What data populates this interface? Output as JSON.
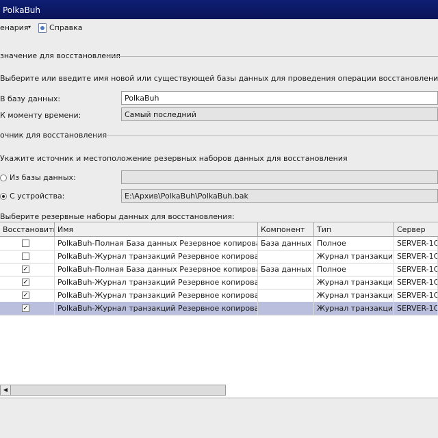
{
  "window": {
    "title": "PolkaBuh"
  },
  "toolbar": {
    "script_label": "енария",
    "script_arrow": "▾",
    "help_label": "Справка"
  },
  "destination": {
    "title": "значение для восстановления",
    "description": "Выберите или введите имя новой или существующей базы данных для проведения операции восстановления",
    "database_label": "В базу данных:",
    "database_value": "PolkaBuh",
    "point_in_time_label": "К моменту времени:",
    "point_in_time_value": "Самый последний"
  },
  "source": {
    "title": "очник для восстановления",
    "description": "Укажите источник и местоположение резервных наборов данных для восстановления",
    "from_database_label": "Из базы данных:",
    "from_database_value": "",
    "from_device_label": "С устройства:",
    "from_device_value": "E:\\Архив\\PolkaBuh\\PolkaBuh.bak"
  },
  "backup_sets": {
    "title": "Выберите резервные наборы данных для восстановления:",
    "columns": [
      "Восстановить",
      "Имя",
      "Компонент",
      "Тип",
      "Сервер"
    ],
    "rows": [
      {
        "restore": false,
        "name": "PolkaBuh-Полная База данных Резервное копирование",
        "component": "База данных",
        "type": "Полное",
        "server": "SERVER-1C"
      },
      {
        "restore": false,
        "name": "PolkaBuh-Журнал транзакций Резервное копирование",
        "component": "",
        "type": "Журнал транзакций",
        "server": "SERVER-1C"
      },
      {
        "restore": true,
        "name": "PolkaBuh-Полная База данных Резервное копирование",
        "component": "База данных",
        "type": "Полное",
        "server": "SERVER-1C"
      },
      {
        "restore": true,
        "name": "PolkaBuh-Журнал транзакций Резервное копирование",
        "component": "",
        "type": "Журнал транзакций",
        "server": "SERVER-1C"
      },
      {
        "restore": true,
        "name": "PolkaBuh-Журнал транзакций Резервное копирование",
        "component": "",
        "type": "Журнал транзакций",
        "server": "SERVER-1C"
      },
      {
        "restore": true,
        "name": "PolkaBuh-Журнал транзакций Резервное копирование",
        "component": "",
        "type": "Журнал транзакций",
        "server": "SERVER-1C",
        "selected": true
      }
    ]
  },
  "icons": {
    "help": "help-book-icon",
    "checked": "✓",
    "scroll_left": "◀"
  },
  "colors": {
    "title_bar": "#0e1e74",
    "selected_row": "#b9bfdc"
  }
}
